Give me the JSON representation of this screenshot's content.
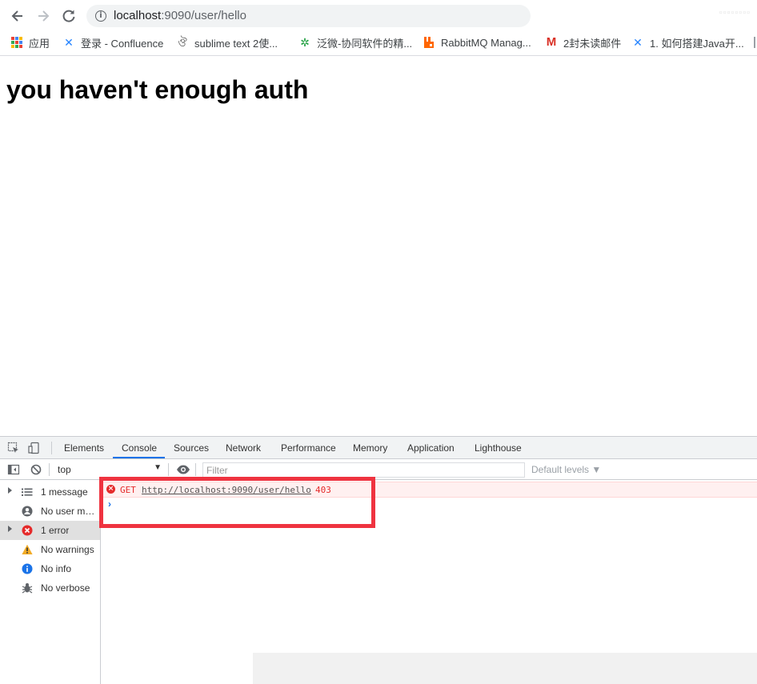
{
  "browser": {
    "url_host": "localhost",
    "url_rest": ":9090/user/hello",
    "bookmarks": [
      {
        "label": "应用",
        "icon": "apps-grid-icon"
      },
      {
        "label": "登录 - Confluence",
        "icon": "confluence-icon",
        "color": "#2684ff"
      },
      {
        "label": "sublime text 2使...",
        "icon": "sublime-icon"
      },
      {
        "label": "泛微-协同软件的精...",
        "icon": "weaver-icon",
        "color": "#1e9e3e"
      },
      {
        "label": "RabbitMQ Manag...",
        "icon": "rabbitmq-icon",
        "color": "#ff6600"
      },
      {
        "label": "2封未读邮件",
        "icon": "gmail-icon",
        "color": "#d93025"
      },
      {
        "label": "1. 如何搭建Java开...",
        "icon": "confluence-icon",
        "color": "#2684ff"
      }
    ]
  },
  "page": {
    "heading": "you haven't enough auth"
  },
  "devtools": {
    "tabs": [
      "Elements",
      "Console",
      "Sources",
      "Network",
      "Performance",
      "Memory",
      "Application",
      "Lighthouse"
    ],
    "active_tab": "Console",
    "context": "top",
    "filter_placeholder": "Filter",
    "levels_label": "Default levels ▼",
    "sidebar": [
      {
        "label": "1 message",
        "icon": "list-icon",
        "expandable": true
      },
      {
        "label": "No user me...",
        "icon": "user-icon",
        "expandable": false
      },
      {
        "label": "1 error",
        "icon": "error-icon",
        "expandable": true,
        "selected": true
      },
      {
        "label": "No warnings",
        "icon": "warning-icon",
        "expandable": false
      },
      {
        "label": "No info",
        "icon": "info-icon",
        "expandable": false
      },
      {
        "label": "No verbose",
        "icon": "bug-icon",
        "expandable": false
      }
    ],
    "console": {
      "error": {
        "method": "GET",
        "url": "http://localhost:9090/user/hello",
        "status": "403"
      },
      "prompt": "›"
    }
  },
  "colors": {
    "accent": "#1a73e8",
    "error": "#e52b2b",
    "highlight": "#ef3340"
  }
}
